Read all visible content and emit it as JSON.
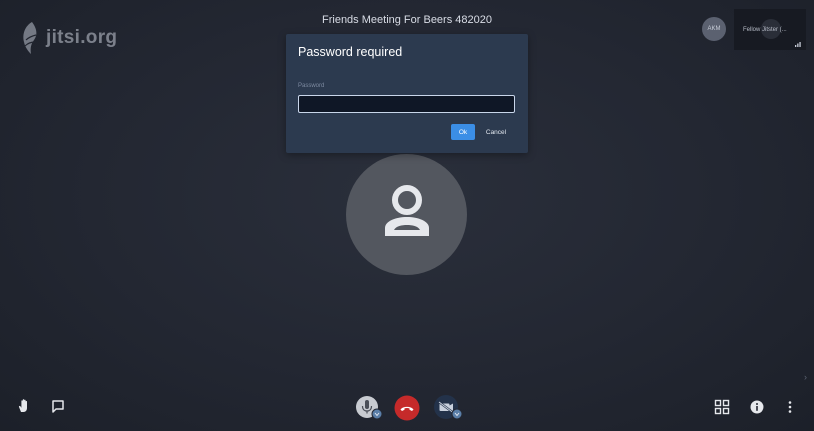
{
  "logo": {
    "text": "jitsi.org",
    "icon": "jitsi-logo-icon"
  },
  "meeting": {
    "title": "Friends Meeting For Beers 482020"
  },
  "local_user": {
    "initials": "AKM"
  },
  "filmstrip": {
    "participant_name": "Fellow Jitster (..."
  },
  "dialog": {
    "title": "Password required",
    "field_label": "Password",
    "password_value": "",
    "ok_label": "Ok",
    "cancel_label": "Cancel"
  },
  "toolbar": {
    "left": [
      "raise-hand-icon",
      "chat-icon"
    ],
    "center": [
      "microphone-muted-icon",
      "hangup-icon",
      "camera-off-icon"
    ],
    "right": [
      "tile-view-icon",
      "info-icon",
      "more-options-icon"
    ]
  },
  "colors": {
    "background": "#232732",
    "dialog": "#2c3a4f",
    "ok_button": "#3b8ee6",
    "hangup": "#c52a2a"
  }
}
